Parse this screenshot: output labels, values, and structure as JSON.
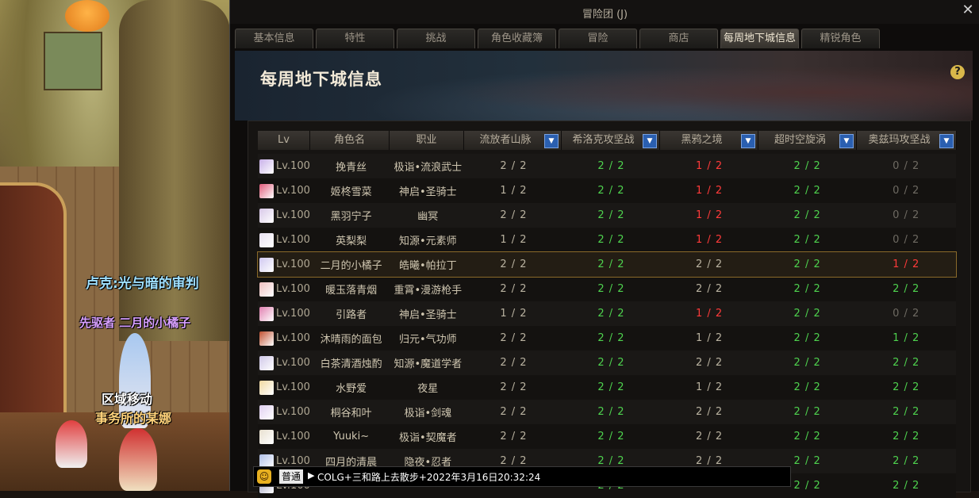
{
  "scene": {
    "npc_title": "卢克:光与暗的审判",
    "player_name": "先驱者 二月的小橘子",
    "portal_label": "区域移动",
    "npc_name": "事务所的某娜"
  },
  "window": {
    "title": "冒险团 (J)",
    "close_icon": "close-icon"
  },
  "tabs": [
    "基本信息",
    "特性",
    "挑战",
    "角色收藏簿",
    "冒险",
    "商店",
    "每周地下城信息",
    "精锐角色"
  ],
  "active_tab": 6,
  "banner": {
    "title": "每周地下城信息",
    "help": "?"
  },
  "table": {
    "headers": [
      "Lv",
      "角色名",
      "职业",
      "流放者山脉",
      "希洛克攻坚战",
      "黑鸦之境",
      "超时空旋涡",
      "奥兹玛攻坚战"
    ],
    "rows": [
      {
        "lv": "Lv.100",
        "name": "挽青丝",
        "job": "极诣•流浪武士",
        "d": [
          "2 / 2",
          "2 / 2",
          "1 / 2",
          "2 / 2",
          "0 / 2"
        ],
        "c": [
          "w",
          "g",
          "r",
          "g",
          "gy"
        ],
        "av": "#c8b0e8"
      },
      {
        "lv": "Lv.100",
        "name": "姬柊雪菜",
        "job": "神启•圣骑士",
        "d": [
          "1 / 2",
          "2 / 2",
          "1 / 2",
          "2 / 2",
          "0 / 2"
        ],
        "c": [
          "w",
          "g",
          "r",
          "g",
          "gy"
        ],
        "av": "#e05a7a"
      },
      {
        "lv": "Lv.100",
        "name": "黑羽宁子",
        "job": "幽冥",
        "d": [
          "2 / 2",
          "2 / 2",
          "1 / 2",
          "2 / 2",
          "0 / 2"
        ],
        "c": [
          "w",
          "g",
          "r",
          "g",
          "gy"
        ],
        "av": "#d8c8e8"
      },
      {
        "lv": "Lv.100",
        "name": "英梨梨",
        "job": "知源•元素师",
        "d": [
          "1 / 2",
          "2 / 2",
          "1 / 2",
          "2 / 2",
          "0 / 2"
        ],
        "c": [
          "w",
          "g",
          "r",
          "g",
          "gy"
        ],
        "av": "#e8e0f0"
      },
      {
        "lv": "Lv.100",
        "name": "二月的小橘子",
        "job": "皓曦•帕拉丁",
        "d": [
          "2 / 2",
          "2 / 2",
          "2 / 2",
          "2 / 2",
          "1 / 2"
        ],
        "c": [
          "w",
          "g",
          "w",
          "g",
          "r"
        ],
        "av": "#d0c8f0",
        "sel": true
      },
      {
        "lv": "Lv.100",
        "name": "暖玉落青烟",
        "job": "重霄•漫游枪手",
        "d": [
          "2 / 2",
          "2 / 2",
          "2 / 2",
          "2 / 2",
          "2 / 2"
        ],
        "c": [
          "w",
          "g",
          "w",
          "g",
          "g"
        ],
        "av": "#f0c0c0"
      },
      {
        "lv": "Lv.100",
        "name": "引路者",
        "job": "神启•圣骑士",
        "d": [
          "1 / 2",
          "2 / 2",
          "1 / 2",
          "2 / 2",
          "0 / 2"
        ],
        "c": [
          "w",
          "g",
          "r",
          "g",
          "gy"
        ],
        "av": "#e080b0"
      },
      {
        "lv": "Lv.100",
        "name": "沐晴雨的面包",
        "job": "归元•气功师",
        "d": [
          "2 / 2",
          "2 / 2",
          "1 / 2",
          "2 / 2",
          "1 / 2"
        ],
        "c": [
          "w",
          "g",
          "w",
          "g",
          "g"
        ],
        "av": "#c05030"
      },
      {
        "lv": "Lv.100",
        "name": "白茶清酒烛酌",
        "job": "知源•魔道学者",
        "d": [
          "2 / 2",
          "2 / 2",
          "2 / 2",
          "2 / 2",
          "2 / 2"
        ],
        "c": [
          "w",
          "g",
          "w",
          "g",
          "g"
        ],
        "av": "#d0c8e8"
      },
      {
        "lv": "Lv.100",
        "name": "水野爱",
        "job": "夜星",
        "d": [
          "2 / 2",
          "2 / 2",
          "1 / 2",
          "2 / 2",
          "2 / 2"
        ],
        "c": [
          "w",
          "g",
          "w",
          "g",
          "g"
        ],
        "av": "#f0d8a0"
      },
      {
        "lv": "Lv.100",
        "name": "桐谷和叶",
        "job": "极诣•剑魂",
        "d": [
          "2 / 2",
          "2 / 2",
          "2 / 2",
          "2 / 2",
          "2 / 2"
        ],
        "c": [
          "w",
          "g",
          "w",
          "g",
          "g"
        ],
        "av": "#e0d0f0"
      },
      {
        "lv": "Lv.100",
        "name": "Yuuki~",
        "job": "极诣•契魔者",
        "d": [
          "2 / 2",
          "2 / 2",
          "2 / 2",
          "2 / 2",
          "2 / 2"
        ],
        "c": [
          "w",
          "g",
          "w",
          "g",
          "g"
        ],
        "av": "#e8e0d0"
      },
      {
        "lv": "Lv.100",
        "name": "四月的清晨",
        "job": "隐夜•忍者",
        "d": [
          "2 / 2",
          "2 / 2",
          "2 / 2",
          "2 / 2",
          "2 / 2"
        ],
        "c": [
          "w",
          "g",
          "w",
          "g",
          "g"
        ],
        "av": "#b0c0e8"
      },
      {
        "lv": "Lv.100",
        "name": "",
        "job": "",
        "d": [
          "",
          "2 / 2",
          "",
          "2 / 2",
          "2 / 2"
        ],
        "c": [
          "w",
          "g",
          "w",
          "g",
          "g"
        ],
        "av": "#a0a0c0"
      }
    ]
  },
  "chat": {
    "icon": "chat-emoji-icon",
    "mode": "普通",
    "value": "COLG+三和路上去散步+2022年3月16日20:32:24"
  }
}
